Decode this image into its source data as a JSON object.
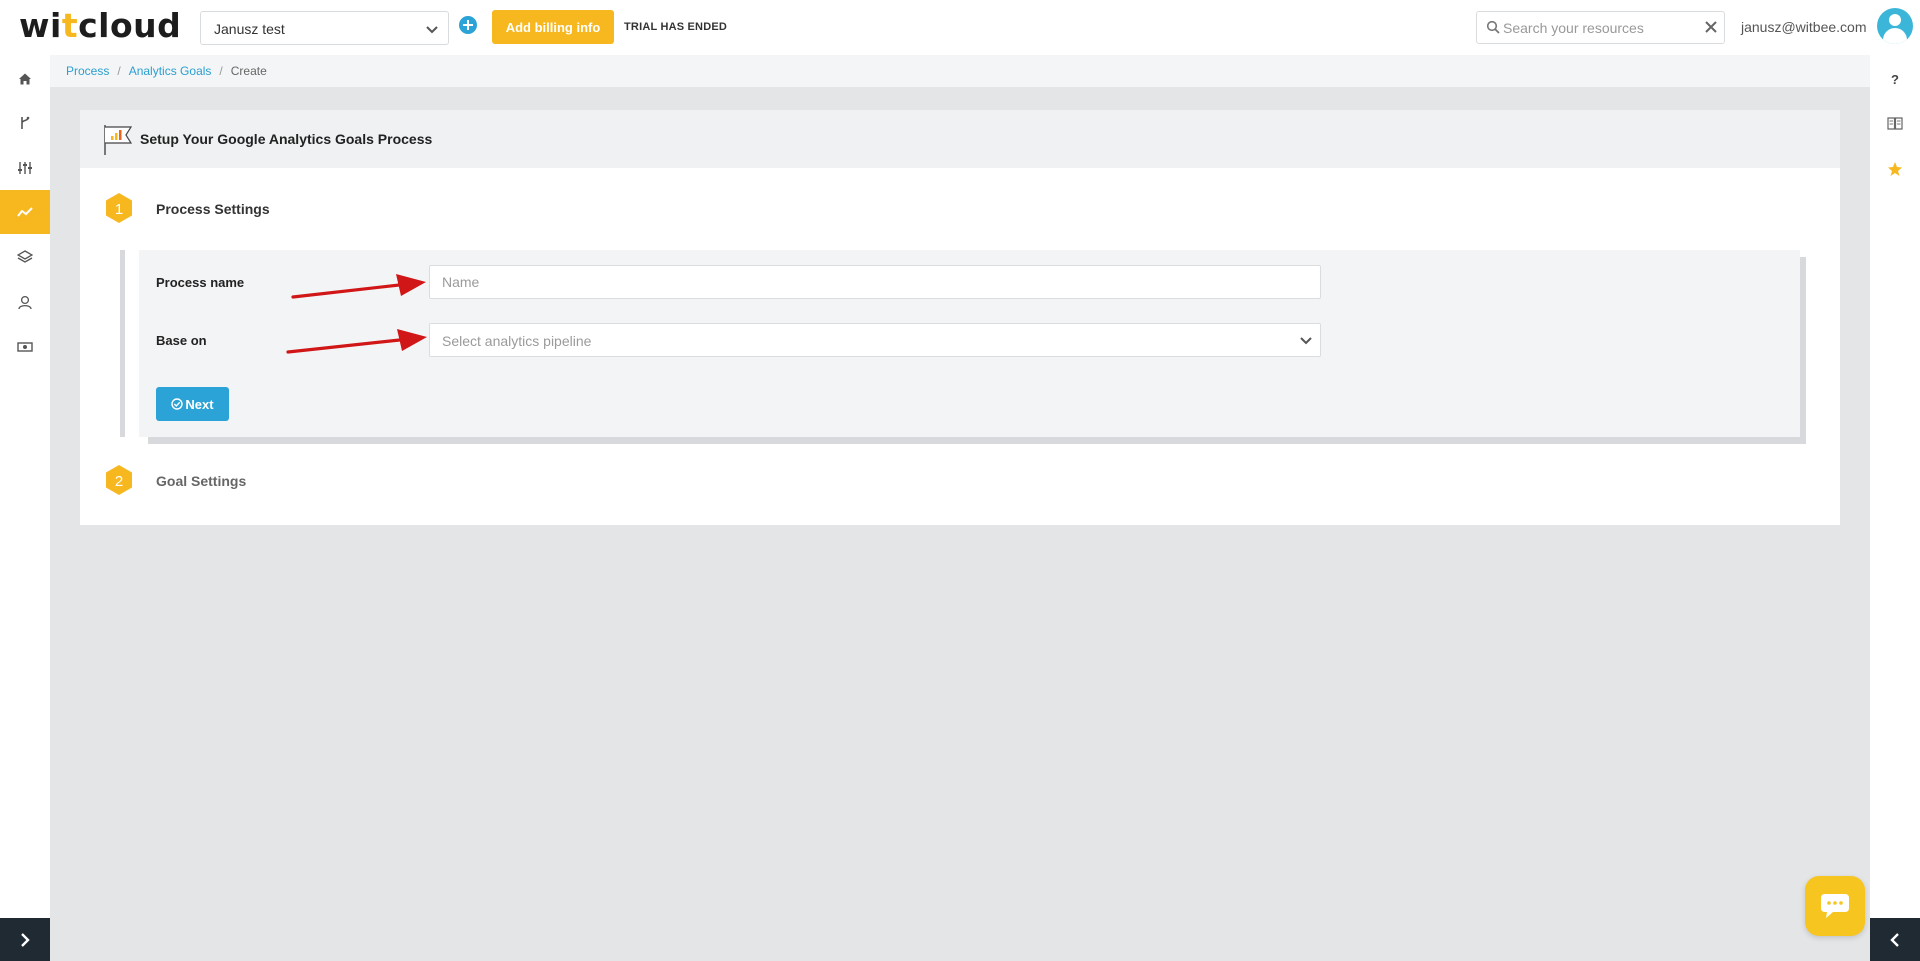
{
  "app": {
    "logo_prefix": "wi",
    "logo_accent": "t",
    "logo_suffix": "cloud"
  },
  "topbar": {
    "org_selected": "Janusz test",
    "billing_label": "Add billing info",
    "trial_status": "TRIAL HAS ENDED",
    "search_placeholder": "Search your resources",
    "user_email": "janusz@witbee.com"
  },
  "sidebar": {
    "items": [
      {
        "icon": "home-icon",
        "active": false
      },
      {
        "icon": "pipeline-icon",
        "active": false
      },
      {
        "icon": "sliders-icon",
        "active": false
      },
      {
        "icon": "analytics-icon",
        "active": true
      },
      {
        "icon": "layers-icon",
        "active": false
      },
      {
        "icon": "user-icon",
        "active": false
      },
      {
        "icon": "billing-icon",
        "active": false
      }
    ]
  },
  "right_sidebar": {
    "items": [
      {
        "icon": "help-icon",
        "label": "?"
      },
      {
        "icon": "book-icon"
      },
      {
        "icon": "star-icon"
      }
    ]
  },
  "breadcrumb": {
    "items": [
      "Process",
      "Analytics Goals",
      "Create"
    ],
    "separator": "/"
  },
  "card": {
    "title": "Setup Your Google Analytics Goals Process",
    "steps": [
      {
        "number": "1",
        "title": "Process Settings"
      },
      {
        "number": "2",
        "title": "Goal Settings"
      }
    ]
  },
  "form": {
    "process_name_label": "Process name",
    "process_name_placeholder": "Name",
    "process_name_value": "",
    "base_on_label": "Base on",
    "base_on_placeholder": "Select analytics pipeline",
    "next_label": "Next"
  },
  "colors": {
    "accent": "#f7b81f",
    "primary": "#2ba3d6",
    "annotation_arrow": "#d01616"
  }
}
